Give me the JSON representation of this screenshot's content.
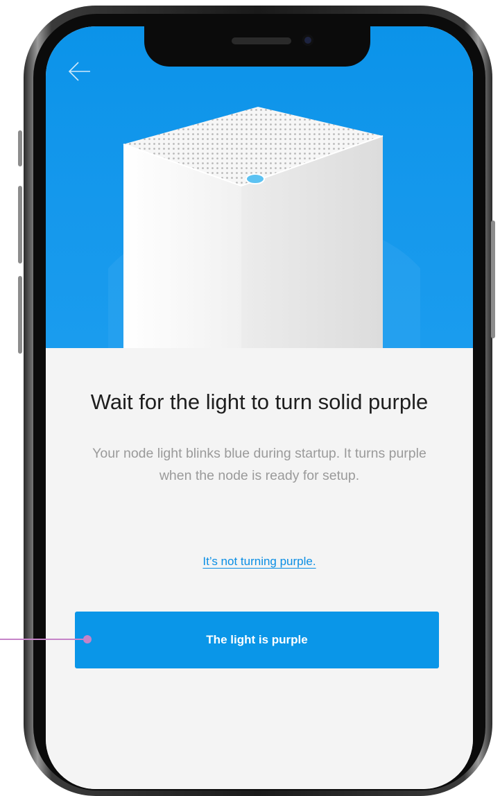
{
  "screen": {
    "back_icon": "arrow-left-icon",
    "hero_image": "white-mesh-node-with-light",
    "title": "Wait for the light to turn solid purple",
    "description": "Your node light blinks blue during startup. It turns purple when the node is ready for setup.",
    "help_link": "It’s not turning purple.",
    "primary_button": "The light is purple"
  },
  "colors": {
    "hero_background": "#0b93e9",
    "accent": "#0a96e8",
    "link": "#0a8ee4",
    "content_background": "#f4f4f4",
    "callout": "#c583c8"
  }
}
